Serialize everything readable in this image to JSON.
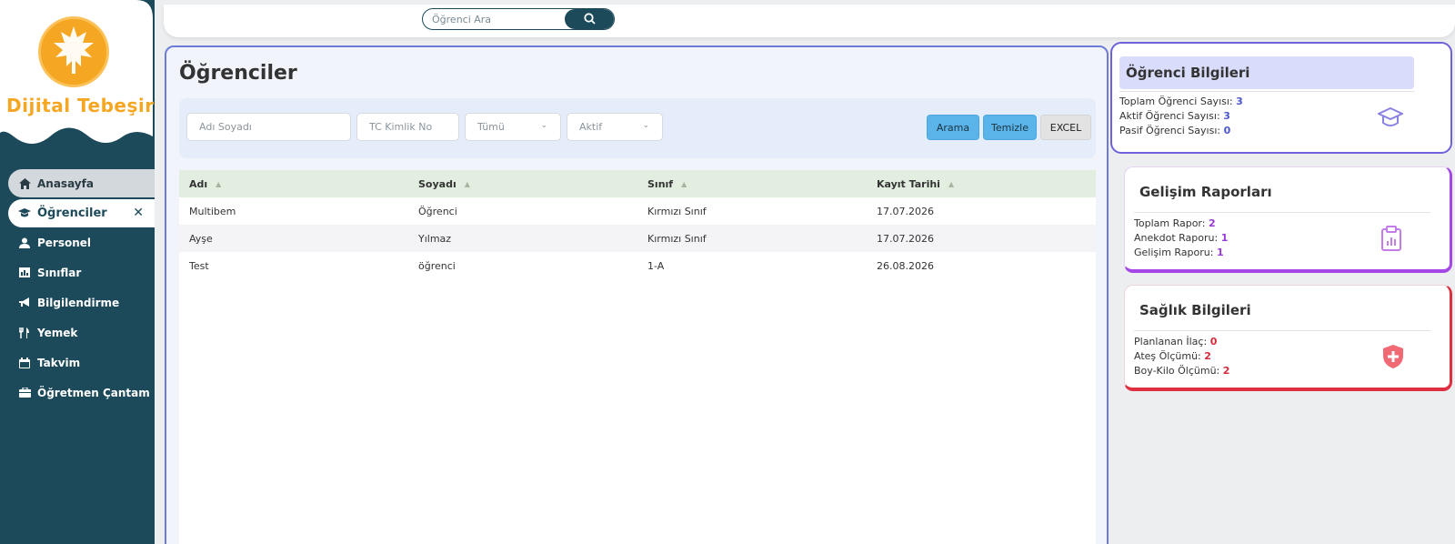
{
  "brand": {
    "name": "Dijital Tebeşir"
  },
  "search": {
    "placeholder": "Öğrenci Ara"
  },
  "sidebar": {
    "items": [
      {
        "label": "Anasayfa",
        "icon": "home-icon"
      },
      {
        "label": "Öğrenciler",
        "icon": "student-icon",
        "close": "✕"
      },
      {
        "label": "Personel",
        "icon": "user-icon"
      },
      {
        "label": "Sınıflar",
        "icon": "chart-icon"
      },
      {
        "label": "Bilgilendirme",
        "icon": "megaphone-icon"
      },
      {
        "label": "Yemek",
        "icon": "food-icon"
      },
      {
        "label": "Takvim",
        "icon": "calendar-icon"
      },
      {
        "label": "Öğretmen Çantam",
        "icon": "briefcase-icon"
      }
    ]
  },
  "main": {
    "title": "Öğrenciler",
    "filters": {
      "name_placeholder": "Adı Soyadı",
      "tc_placeholder": "TC Kimlik No",
      "class_select": "Tümü",
      "status_select": "Aktif"
    },
    "buttons": {
      "search": "Arama",
      "clear": "Temizle",
      "excel": "EXCEL"
    },
    "table": {
      "columns": [
        "Adı",
        "Soyadı",
        "Sınıf",
        "Kayıt Tarihi"
      ],
      "rows": [
        [
          "Multibem",
          "Öğrenci",
          "Kırmızı Sınıf",
          "17.07.2026"
        ],
        [
          "Ayşe",
          "Yılmaz",
          "Kırmızı Sınıf",
          "17.07.2026"
        ],
        [
          "Test",
          "öğrenci",
          "1-A",
          "26.08.2026"
        ]
      ]
    }
  },
  "cards": {
    "student_info": {
      "title": "Öğrenci Bilgileri",
      "total_label": "Toplam Öğrenci Sayısı:",
      "total_value": "3",
      "active_label": "Aktif Öğrenci Sayısı:",
      "active_value": "3",
      "passive_label": "Pasif Öğrenci Sayısı:",
      "passive_value": "0"
    },
    "reports": {
      "title": "Gelişim Raporları",
      "total_label": "Toplam Rapor:",
      "total_value": "2",
      "anecdote_label": "Anekdot Raporu:",
      "anecdote_value": "1",
      "progress_label": "Gelişim Raporu:",
      "progress_value": "1"
    },
    "health": {
      "title": "Sağlık Bilgileri",
      "medicine_label": "Planlanan İlaç:",
      "medicine_value": "0",
      "fever_label": "Ateş Ölçümü:",
      "fever_value": "2",
      "height_label": "Boy-Kilo Ölçümü:",
      "height_value": "2"
    }
  },
  "colors": {
    "sidebar": "#1c4a5a",
    "brand": "#f5a623",
    "accent_blue": "#5ab4ea",
    "card_blue": "#6e62d8",
    "card_purple": "#a547e6",
    "card_red": "#de3040"
  }
}
